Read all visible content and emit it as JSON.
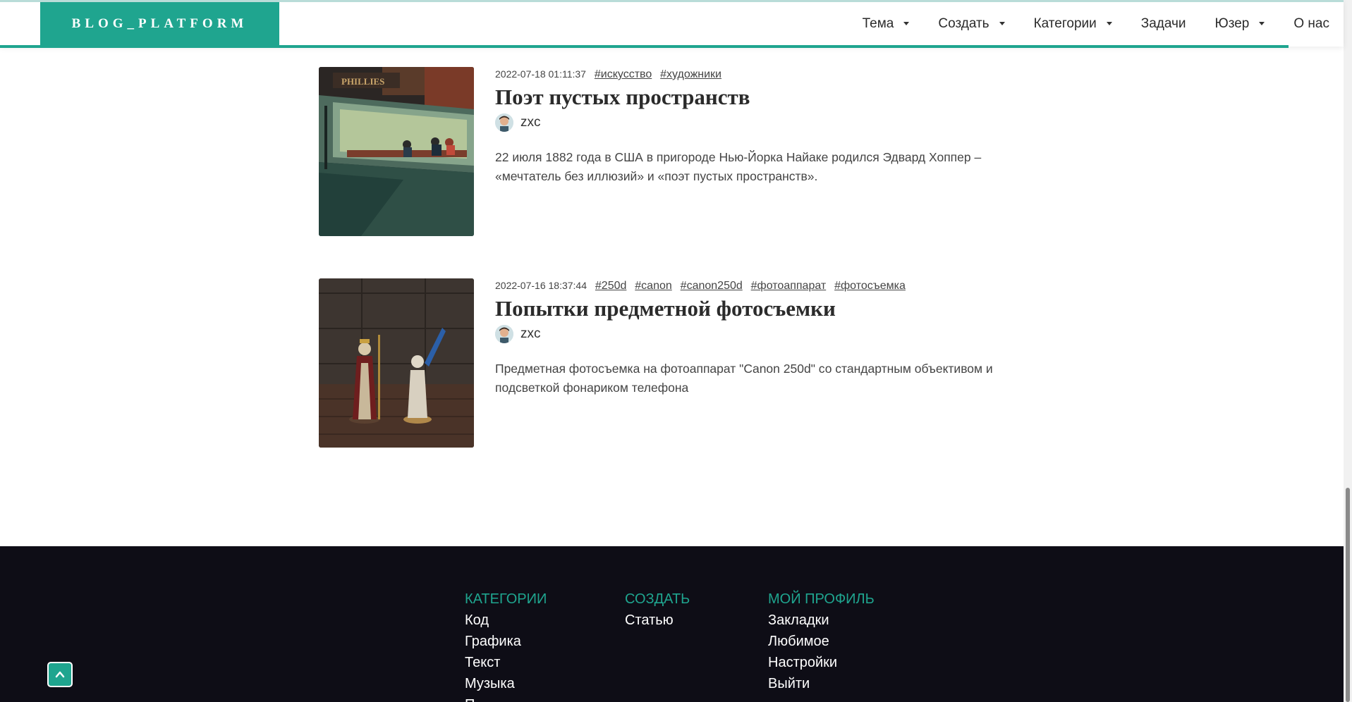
{
  "header": {
    "logo": "BLOG_PLATFORM",
    "nav": [
      {
        "label": "Тема",
        "dropdown": true
      },
      {
        "label": "Создать",
        "dropdown": true
      },
      {
        "label": "Категории",
        "dropdown": true
      },
      {
        "label": "Задачи",
        "dropdown": false
      },
      {
        "label": "Юзер",
        "dropdown": true
      },
      {
        "label": "О нас",
        "dropdown": false
      }
    ]
  },
  "posts": [
    {
      "date": "2022-07-18 01:11:37",
      "tags": [
        "#искусство",
        "#художники"
      ],
      "title": "Поэт пустых пространств",
      "author": "zxc",
      "excerpt": "22 июля 1882 года в США в пригороде Нью-Йорка Найаке родился Эдвард Хоппер – «мечтатель без иллюзий» и «поэт пустых пространств».",
      "thumb_sign": "PHILLIES"
    },
    {
      "date": "2022-07-16 18:37:44",
      "tags": [
        "#250d",
        "#canon",
        "#canon250d",
        "#фотоаппарат",
        "#фотосъемка"
      ],
      "title": "Попытки предметной фотосъемки",
      "author": "zxc",
      "excerpt": "Предметная фотосъемка на фотоаппарат \"Canon 250d\" со стандартным объективом и подсветкой фонариком телефона"
    }
  ],
  "footer": {
    "columns": [
      {
        "title": "КАТЕГОРИИ",
        "items": [
          "Код",
          "Графика",
          "Текст",
          "Музыка",
          "Π"
        ]
      },
      {
        "title": "СОЗДАТЬ",
        "items": [
          "Статью"
        ]
      },
      {
        "title": "МОЙ ПРОФИЛЬ",
        "items": [
          "Закладки",
          "Любимое",
          "Настройки",
          "Выйти"
        ]
      }
    ]
  },
  "scroll_top_icon": "chevron-up-icon",
  "colors": {
    "accent": "#1fa58f",
    "footer_bg": "#0e0d16",
    "header_border": "#b9dcd8"
  }
}
